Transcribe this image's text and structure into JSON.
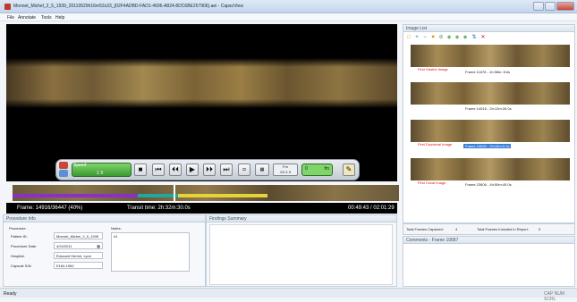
{
  "window": {
    "title": "Monnet_Michel_2_5_1939_20110529h16m52s33_{02F4ADBD-FAD1-4606-A824-8DC6BE257906}.aei - CapsoView"
  },
  "menu": [
    "File",
    "Annotate",
    "Tools",
    "Help"
  ],
  "player": {
    "speed_label": "Speed",
    "speed_value": "1 X",
    "frame_value": "0",
    "frame_unit": "fm",
    "frame_info": "Frame: 14916/36447 (40%)",
    "transit_time": "Transit time: 2h:32m:30.0s",
    "clock": "00:49:43 / 02:01:29",
    "buttons": [
      "■",
      "⏮",
      "⏴⏴",
      "▶",
      "⏵⏵",
      "⏭"
    ],
    "step_label": "Fm",
    "step_value": "X5 X 5"
  },
  "timeline": {
    "position_fraction": 0.41
  },
  "procedure": {
    "header": "Procedure Info",
    "section_label": "Procedure:",
    "patient_id_label": "Patient ID:",
    "patient_id": "Monnet_Michel_2_5_1939",
    "date_label": "Procedure Date:",
    "date": "4/24/2011",
    "hospital_label": "Hospital:",
    "hospital": "Édouard Herriot, Lyon",
    "capsule_label": "Capsule S/N:",
    "capsule": "E184-1562",
    "notes_label": "Notes:",
    "notes": "#1"
  },
  "findings": {
    "header": "Findings Summary"
  },
  "image_list": {
    "header": "Image List",
    "toolbar_icons": [
      "square-icon",
      "plus-icon",
      "minus-icon",
      "heart-icon",
      "link-icon",
      "tag-icon",
      "tag-icon",
      "tag-icon",
      "sort-icon",
      "delete-icon"
    ],
    "items": [
      {
        "tag": "First Gastric Image",
        "caption": "Frame 11676 - 1h:58m: 8.6s",
        "highlight": false
      },
      {
        "tag": "",
        "caption": "Frame 14016 - 2h:12m:30.0s",
        "highlight": false
      },
      {
        "tag": "First Duodenal Image",
        "caption": "Frame 15690 - 2h:40m:5.1s",
        "highlight": true
      },
      {
        "tag": "First Cecal Image",
        "caption": "Frame 23606 - 4h:50m:40.0s",
        "highlight": false
      }
    ],
    "total_captured_label": "Total Frames Captured:",
    "total_captured": "4",
    "total_report_label": "Total Frames Included in Report:",
    "total_report": "0"
  },
  "comments": {
    "header": "Comments - Frame 10687"
  },
  "status": {
    "left": "Ready",
    "right": "CAP NUM SCRL"
  },
  "colors": {
    "accent": "#3c9a32",
    "highlight": "#3d7fd6",
    "tag": "#dd1111"
  }
}
